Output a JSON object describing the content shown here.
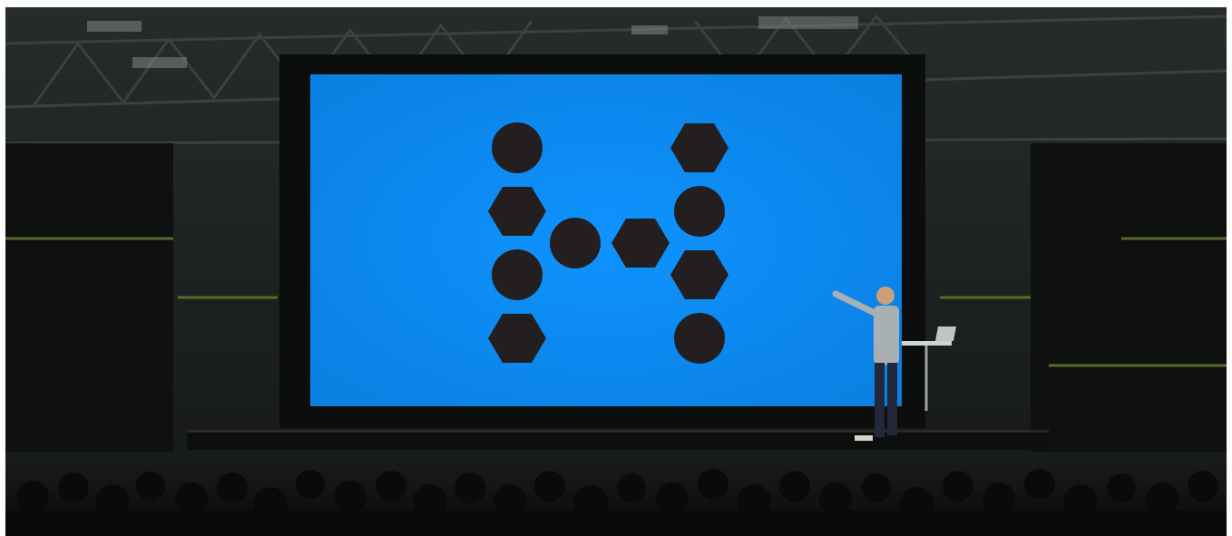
{
  "scene": {
    "description_visible_text": "",
    "screen_color": "#0a8cf6",
    "shape_color": "#231f20",
    "logo_grid": [
      [
        "circle",
        "",
        "hexagon"
      ],
      [
        "hexagon",
        "",
        "circle"
      ],
      [
        "circle",
        "circle-hexagon",
        "hexagon"
      ],
      [
        "hexagon",
        "",
        "circle"
      ]
    ]
  }
}
